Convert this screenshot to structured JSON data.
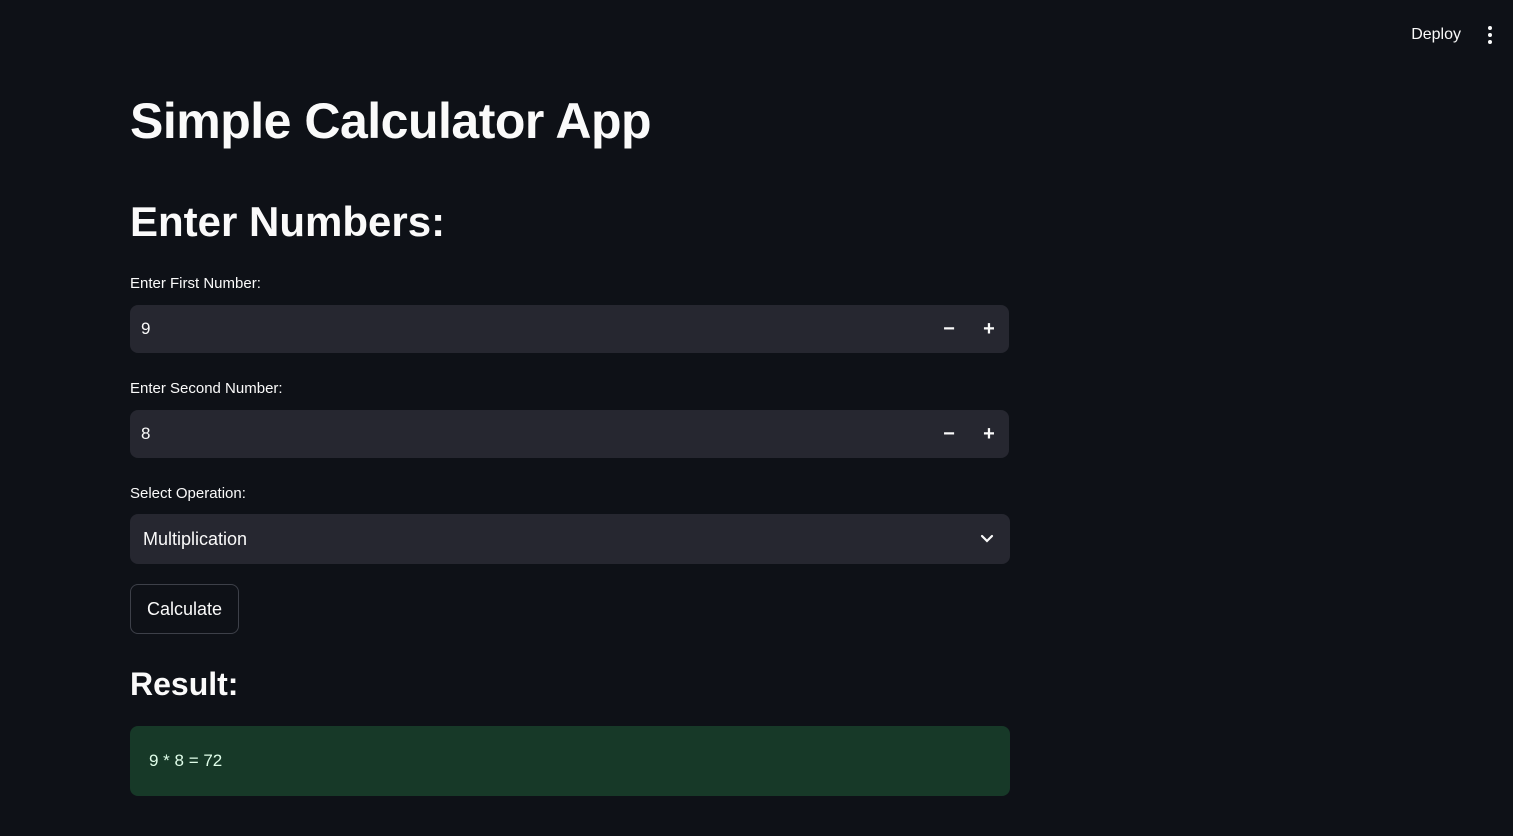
{
  "header": {
    "deploy_label": "Deploy"
  },
  "title": "Simple Calculator App",
  "section_heading": "Enter Numbers:",
  "first_number": {
    "label": "Enter First Number:",
    "value": "9"
  },
  "second_number": {
    "label": "Enter Second Number:",
    "value": "8"
  },
  "operation": {
    "label": "Select Operation:",
    "selected": "Multiplication"
  },
  "calculate_label": "Calculate",
  "result_heading": "Result:",
  "result_text": "9 * 8 = 72",
  "steppers": {
    "minus": "−",
    "plus": "+"
  }
}
